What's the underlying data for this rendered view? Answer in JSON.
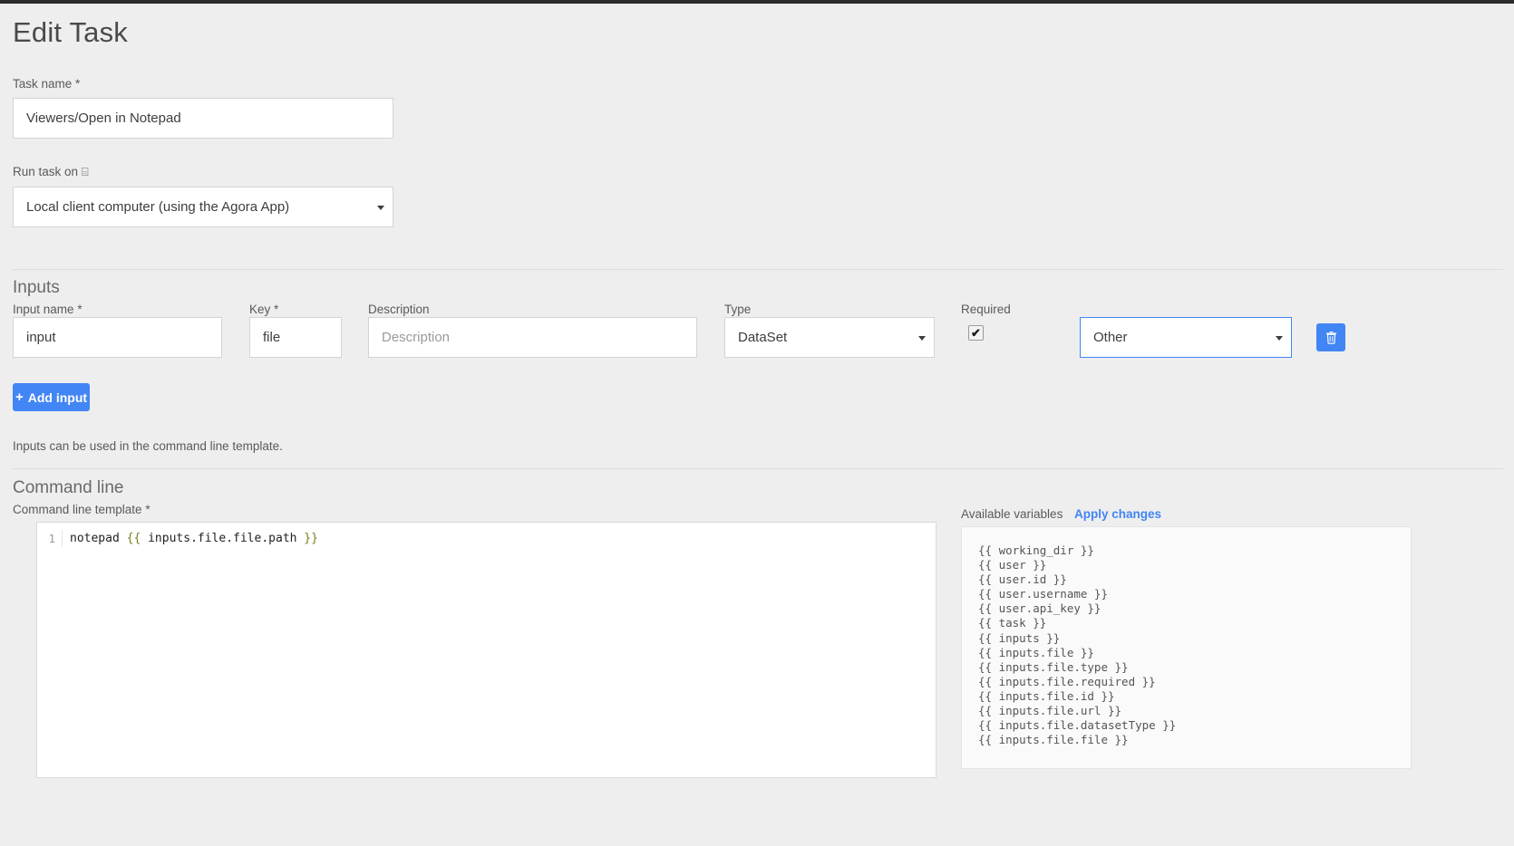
{
  "page": {
    "title": "Edit Task"
  },
  "task_name": {
    "label": "Task name",
    "required_mark": "*",
    "value": "Viewers/Open in Notepad",
    "placeholder": ""
  },
  "run_task_on": {
    "label": "Run task on",
    "icon": "laptop-icon",
    "icon_glyph": "⌸",
    "value": "Local client computer (using the Agora App)",
    "options": [
      "Local client computer (using the Agora App)"
    ]
  },
  "inputs_section": {
    "title": "Inputs",
    "helper_text": "Inputs can be used in the command line template.",
    "add_button_label": "Add input",
    "add_button_plus": "+",
    "columns": {
      "input_name": "Input name",
      "input_name_required_mark": "*",
      "key": "Key",
      "key_required_mark": "*",
      "description": "Description",
      "type": "Type",
      "required": "Required"
    },
    "row": {
      "input_name_value": "input",
      "key_value": "file",
      "description_value": "",
      "description_placeholder": "Description",
      "type_value": "DataSet",
      "type_options": [
        "DataSet"
      ],
      "required_checked": true,
      "required_tick_glyph": "✔",
      "subtype_value": "Other",
      "subtype_options": [
        "Other"
      ],
      "delete_icon": "trash-icon"
    }
  },
  "command_line_section": {
    "title": "Command line",
    "template_label": "Command line template",
    "template_required_mark": "*",
    "editor": {
      "line_number": "1",
      "code_prefix": "notepad ",
      "code_open_brace": "{{",
      "code_variable": " inputs.file.file.path ",
      "code_close_brace": "}}"
    },
    "variables_panel": {
      "header_label": "Available variables",
      "apply_label": "Apply changes",
      "items": [
        "{{ working_dir }}",
        "{{ user }}",
        "{{ user.id }}",
        "{{ user.username }}",
        "{{ user.api_key }}",
        "{{ task }}",
        "{{ inputs }}",
        "{{ inputs.file }}",
        "{{ inputs.file.type }}",
        "{{ inputs.file.required }}",
        "{{ inputs.file.id }}",
        "{{ inputs.file.url }}",
        "{{ inputs.file.datasetType }}",
        "{{ inputs.file.file }}"
      ]
    }
  },
  "colors": {
    "accent": "#4285f4",
    "background": "#eeeeee",
    "panel": "#fafafa",
    "text": "#333333",
    "muted": "#5a5a5a",
    "brace": "#7d7d1e"
  }
}
